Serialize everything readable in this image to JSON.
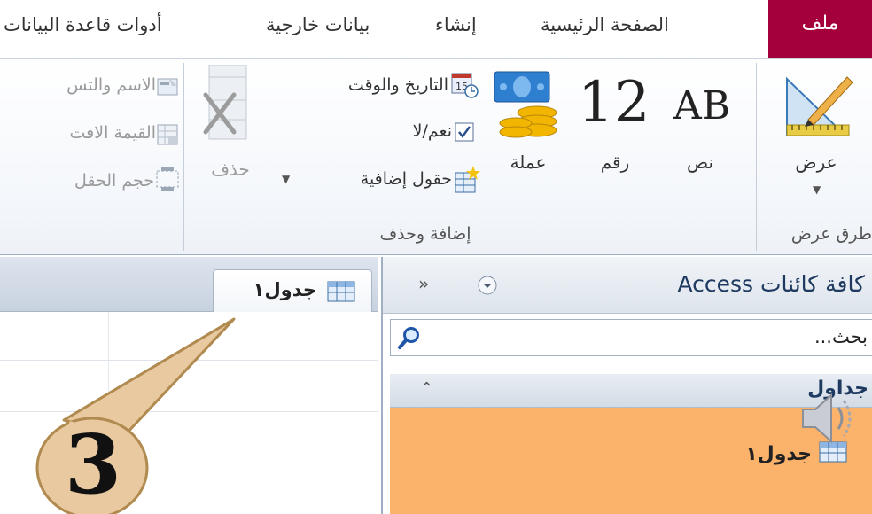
{
  "ribbon_tabs": {
    "file": "ملف",
    "home": "الصفحة الرئيسية",
    "create": "إنشاء",
    "external_data": "بيانات خارجية",
    "database_tools": "أدوات قاعدة البيانات"
  },
  "views_group": {
    "view_button": "عرض",
    "label": "طرق عرض"
  },
  "add_delete_group": {
    "text_button": "نص",
    "number_button": "رقم",
    "currency_button": "عملة",
    "date_time": "التاريخ والوقت",
    "yes_no": "نعم/لا",
    "more_fields": "حقول إضافية",
    "delete_button": "حذف",
    "label": "إضافة وحذف",
    "text_icon_glyph": "AB",
    "number_icon_glyph": "12"
  },
  "properties_group": {
    "name_caption": "الاسم والتس",
    "default_value": "القيمة الافت",
    "field_size": "حجم الحقل"
  },
  "document_tab": {
    "label": "جدول١"
  },
  "navigation_pane": {
    "title": "كافة كائنات Access",
    "search_placeholder": "بحث...",
    "group_header": "جداول",
    "item": "جدول١"
  },
  "callout": {
    "number": "3"
  },
  "colors": {
    "file_tab": "#a3003c",
    "selected_group": "#fbb36b",
    "callout_fill": "#e8c9a0",
    "callout_border": "#b08a4f"
  }
}
